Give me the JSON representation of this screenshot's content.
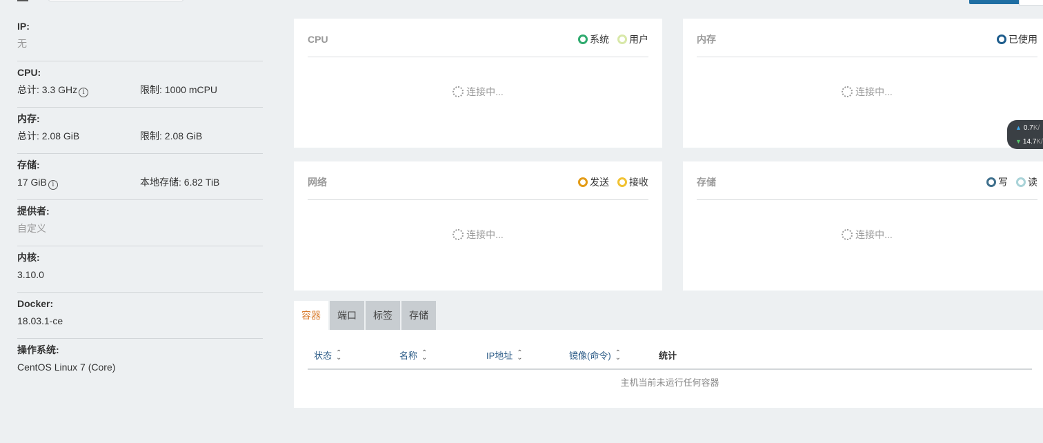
{
  "info": {
    "ip": {
      "label": "IP:",
      "value": "无"
    },
    "cpu": {
      "label": "CPU:",
      "total": "总计: 3.3 GHz",
      "limit": "限制: 1000 mCPU"
    },
    "memory": {
      "label": "内存:",
      "total": "总计: 2.08 GiB",
      "limit": "限制: 2.08 GiB"
    },
    "storage": {
      "label": "存储:",
      "total": "17 GiB",
      "local": "本地存储: 6.82 TiB"
    },
    "provider": {
      "label": "提供者:",
      "value": "自定义"
    },
    "kernel": {
      "label": "内核:",
      "value": "3.10.0"
    },
    "docker": {
      "label": "Docker:",
      "value": "18.03.1-ce"
    },
    "os": {
      "label": "操作系统:",
      "value": "CentOS Linux 7 (Core)"
    },
    "info_icon": "i"
  },
  "cards": {
    "cpu": {
      "title": "CPU",
      "legend": [
        {
          "label": "系统",
          "color": "#2eaa6e"
        },
        {
          "label": "用户",
          "color": "#d8e8a8"
        }
      ],
      "status": "连接中..."
    },
    "memory": {
      "title": "内存",
      "legend": [
        {
          "label": "已使用",
          "color": "#1d5c8c"
        }
      ],
      "status": "连接中..."
    },
    "network": {
      "title": "网络",
      "legend": [
        {
          "label": "发送",
          "color": "#e39b16"
        },
        {
          "label": "接收",
          "color": "#f1c232"
        }
      ],
      "status": "连接中..."
    },
    "storage": {
      "title": "存储",
      "legend": [
        {
          "label": "写",
          "color": "#3e6f8c"
        },
        {
          "label": "读",
          "color": "#a9d3d8"
        }
      ],
      "status": "连接中..."
    }
  },
  "speed": {
    "up": "0.7",
    "up_unit": "K/",
    "down": "14.7",
    "down_unit": "K/"
  },
  "tabs": [
    {
      "label": "容器",
      "active": true
    },
    {
      "label": "端口",
      "active": false
    },
    {
      "label": "标签",
      "active": false
    },
    {
      "label": "存储",
      "active": false
    }
  ],
  "table": {
    "columns": [
      "状态",
      "名称",
      "IP地址",
      "镜像(命令)",
      "统计"
    ],
    "empty_text": "主机当前未运行任何容器"
  }
}
